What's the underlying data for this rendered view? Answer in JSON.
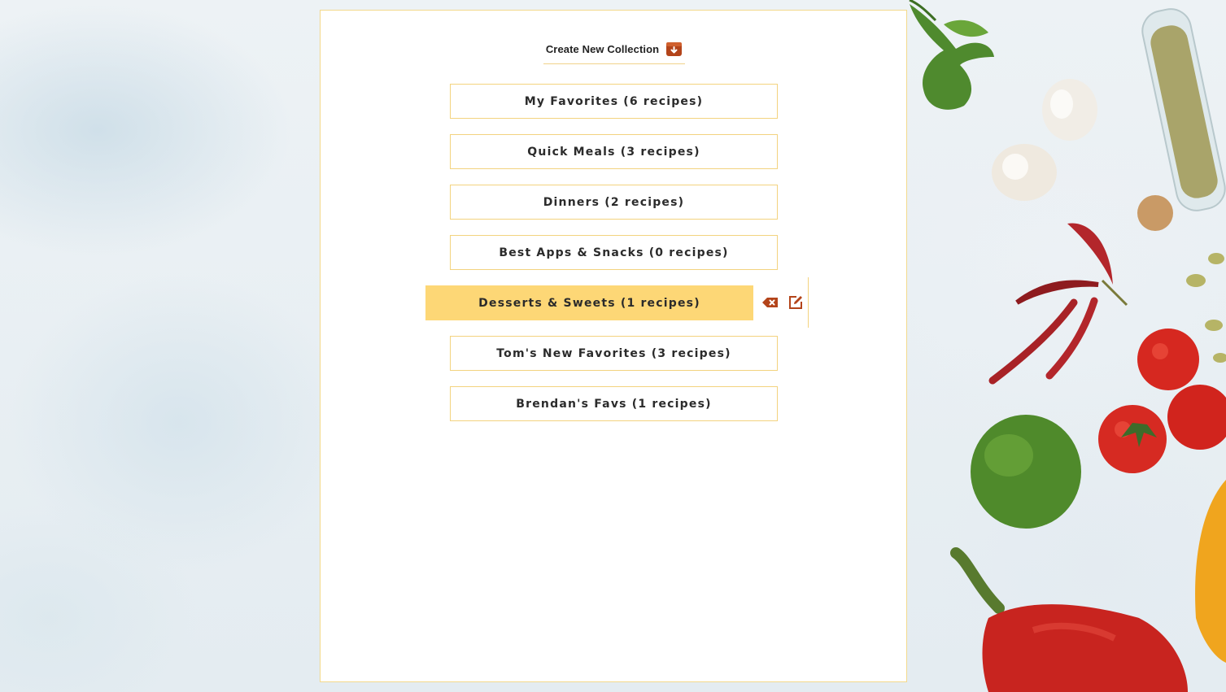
{
  "toolbar": {
    "create_label": "Create New Collection",
    "create_icon": "archive-download-icon"
  },
  "collections": [
    {
      "label": "My Favorites (6 recipes)",
      "active": false
    },
    {
      "label": "Quick Meals (3 recipes)",
      "active": false
    },
    {
      "label": "Dinners (2 recipes)",
      "active": false
    },
    {
      "label": "Best Apps & Snacks (0 recipes)",
      "active": false
    },
    {
      "label": "Desserts & Sweets (1 recipes)",
      "active": true
    },
    {
      "label": "Tom's New Favorites (3 recipes)",
      "active": false
    },
    {
      "label": "Brendan's Favs (1 recipes)",
      "active": false
    }
  ],
  "active_actions": {
    "delete_icon": "backspace-delete-icon",
    "edit_icon": "edit-square-icon"
  },
  "colors": {
    "accent": "#fdd776",
    "border": "#f3d37f",
    "icon": "#b3441a"
  }
}
